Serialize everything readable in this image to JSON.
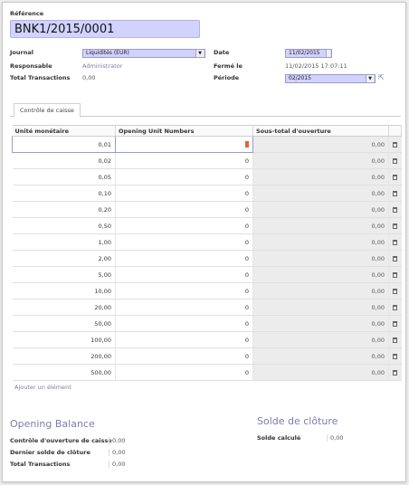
{
  "header": {
    "reference_label": "Référence",
    "reference_value": "BNK1/2015/0001"
  },
  "fields_left": {
    "journal_label": "Journal",
    "journal_value": "Liquidités (EUR)",
    "responsable_label": "Responsable",
    "responsable_value": "Administrator",
    "total_label": "Total Transactions",
    "total_value": "0,00"
  },
  "fields_right": {
    "date_label": "Date",
    "date_value": "11/02/2015",
    "ferme_label": "Fermé le",
    "ferme_value": "11/02/2015 17:07:11",
    "periode_label": "Période",
    "periode_value": "02/2015"
  },
  "tabs": [
    {
      "label": "Contrôle de caisse",
      "active": true
    }
  ],
  "table": {
    "columns": [
      "Unité monétaire",
      "Opening Unit Numbers",
      "Sous-total d'ouverture"
    ],
    "rows": [
      {
        "unit": "0,01",
        "number": "0",
        "subtotal": "0,00"
      },
      {
        "unit": "0,02",
        "number": "0",
        "subtotal": "0,00"
      },
      {
        "unit": "0,05",
        "number": "0",
        "subtotal": "0,00"
      },
      {
        "unit": "0,10",
        "number": "0",
        "subtotal": "0,00"
      },
      {
        "unit": "0,20",
        "number": "0",
        "subtotal": "0,00"
      },
      {
        "unit": "0,50",
        "number": "0",
        "subtotal": "0,00"
      },
      {
        "unit": "1,00",
        "number": "0",
        "subtotal": "0,00"
      },
      {
        "unit": "2,00",
        "number": "0",
        "subtotal": "0,00"
      },
      {
        "unit": "5,00",
        "number": "0",
        "subtotal": "0,00"
      },
      {
        "unit": "10,00",
        "number": "0",
        "subtotal": "0,00"
      },
      {
        "unit": "20,00",
        "number": "0",
        "subtotal": "0,00"
      },
      {
        "unit": "50,00",
        "number": "0",
        "subtotal": "0,00"
      },
      {
        "unit": "100,00",
        "number": "0",
        "subtotal": "0,00"
      },
      {
        "unit": "200,00",
        "number": "0",
        "subtotal": "0,00"
      },
      {
        "unit": "500,00",
        "number": "0",
        "subtotal": "0,00"
      }
    ],
    "add_line_label": "Ajouter un élément"
  },
  "opening_balance": {
    "title": "Opening Balance",
    "controle_label": "Contrôle d'ouverture de caisse",
    "controle_value": "0,00",
    "dernier_label": "Dernier solde de clôture",
    "dernier_value": "0,00",
    "total_label": "Total Transactions",
    "total_value": "0,00"
  },
  "closing_balance": {
    "title": "Solde de clôture",
    "calcule_label": "Solde calculé",
    "calcule_value": "0,00"
  },
  "colors": {
    "accent": "#7c7bad",
    "required_field": "#d2d2ff",
    "readonly_cell": "#ececec"
  }
}
